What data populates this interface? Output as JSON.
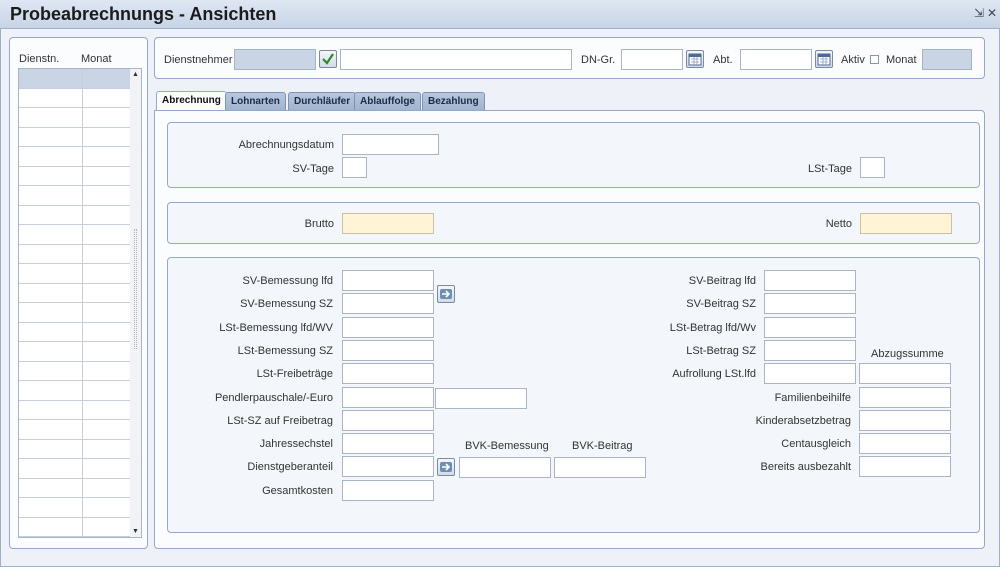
{
  "window": {
    "title": "Probeabrechnungs - Ansichten",
    "minimize_glyph": "⇲",
    "close_glyph": "✕"
  },
  "left_list": {
    "col1": "Dienstn.",
    "col2": "Monat",
    "row_count": 24
  },
  "header": {
    "dienstnehmer_label": "Dienstnehmer",
    "dngr_label": "DN-Gr.",
    "abt_label": "Abt.",
    "aktiv_label": "Aktiv",
    "monat_label": "Monat"
  },
  "tabs": [
    "Abrechnung",
    "Lohnarten",
    "Durchläufer",
    "Ablauffolge",
    "Bezahlung"
  ],
  "section1": {
    "abrechnungsdatum": "Abrechnungsdatum",
    "sv_tage": "SV-Tage",
    "lst_tage": "LSt-Tage"
  },
  "section2": {
    "brutto": "Brutto",
    "netto": "Netto"
  },
  "section3": {
    "left": [
      "SV-Bemessung lfd",
      "SV-Bemessung SZ",
      "LSt-Bemessung lfd/WV",
      "LSt-Bemessung SZ",
      "LSt-Freibeträge",
      "Pendlerpauschale/-Euro",
      "LSt-SZ auf Freibetrag",
      "Jahressechstel",
      "Dienstgeberanteil",
      "Gesamtkosten"
    ],
    "bvk_bemessung": "BVK-Bemessung",
    "bvk_beitrag": "BVK-Beitrag",
    "right": [
      "SV-Beitrag lfd",
      "SV-Beitrag SZ",
      "LSt-Betrag lfd/Wv",
      "LSt-Betrag SZ",
      "Aufrollung LSt.lfd"
    ],
    "abzugssumme": "Abzugssumme",
    "right2": [
      "Familienbeihilfe",
      "Kinderabsetzbetrag",
      "Centausgleich",
      "Bereits ausbezahlt"
    ]
  },
  "icons": {
    "check": "check-icon",
    "calendar": "calendar-icon",
    "arrow": "arrow-right-icon"
  },
  "colors": {
    "grey_field": "#c9d4e4",
    "yellow_field": "#fff4d6",
    "tab_bar": "#a0b3d0"
  }
}
